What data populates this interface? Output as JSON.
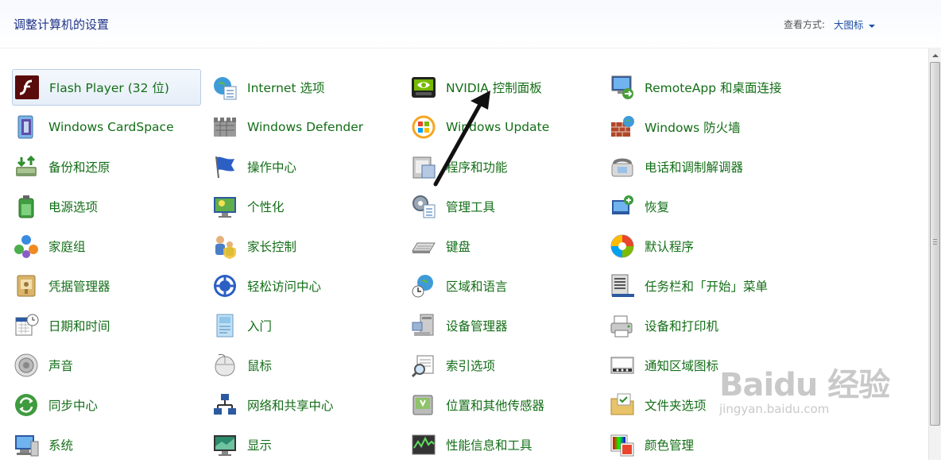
{
  "header": {
    "title": "调整计算机的设置",
    "view_by_label": "查看方式:",
    "view_by_value": "大图标"
  },
  "items": [
    [
      "Flash Player (32 位)",
      "Internet 选项",
      "NVIDIA 控制面板",
      "RemoteApp 和桌面连接"
    ],
    [
      "Windows CardSpace",
      "Windows Defender",
      "Windows Update",
      "Windows 防火墙"
    ],
    [
      "备份和还原",
      "操作中心",
      "程序和功能",
      "电话和调制解调器"
    ],
    [
      "电源选项",
      "个性化",
      "管理工具",
      "恢复"
    ],
    [
      "家庭组",
      "家长控制",
      "键盘",
      "默认程序"
    ],
    [
      "凭据管理器",
      "轻松访问中心",
      "区域和语言",
      "任务栏和「开始」菜单"
    ],
    [
      "日期和时间",
      "入门",
      "设备管理器",
      "设备和打印机"
    ],
    [
      "声音",
      "鼠标",
      "索引选项",
      "通知区域图标"
    ],
    [
      "同步中心",
      "网络和共享中心",
      "位置和其他传感器",
      "文件夹选项"
    ],
    [
      "系统",
      "显示",
      "性能信息和工具",
      "颜色管理"
    ]
  ],
  "icons": [
    [
      "flash-player-icon",
      "internet-options-icon",
      "nvidia-icon",
      "remoteapp-icon"
    ],
    [
      "cardspace-icon",
      "defender-icon",
      "windows-update-icon",
      "firewall-icon"
    ],
    [
      "backup-icon",
      "action-center-flag-icon",
      "programs-icon",
      "phone-modem-icon"
    ],
    [
      "power-icon",
      "personalization-icon",
      "admin-tools-icon",
      "recovery-icon"
    ],
    [
      "homegroup-icon",
      "parental-controls-icon",
      "keyboard-icon",
      "default-programs-icon"
    ],
    [
      "credential-icon",
      "ease-of-access-icon",
      "region-language-icon",
      "taskbar-icon"
    ],
    [
      "date-time-icon",
      "getting-started-icon",
      "device-manager-icon",
      "printer-icon"
    ],
    [
      "sound-icon",
      "mouse-icon",
      "indexing-icon",
      "notification-icon"
    ],
    [
      "sync-icon",
      "network-icon",
      "sensor-icon",
      "folder-icon"
    ],
    [
      "system-icon",
      "display-icon",
      "performance-icon",
      "color-management-icon"
    ]
  ],
  "selected_item": "Flash Player (32 位)",
  "colors": {
    "title": "#1e3287",
    "item_text": "#136e17",
    "link": "#1e50a2",
    "selection": "#e6eef8"
  },
  "watermark": {
    "logo": "Baidu 经验",
    "url": "jingyan.baidu.com"
  }
}
